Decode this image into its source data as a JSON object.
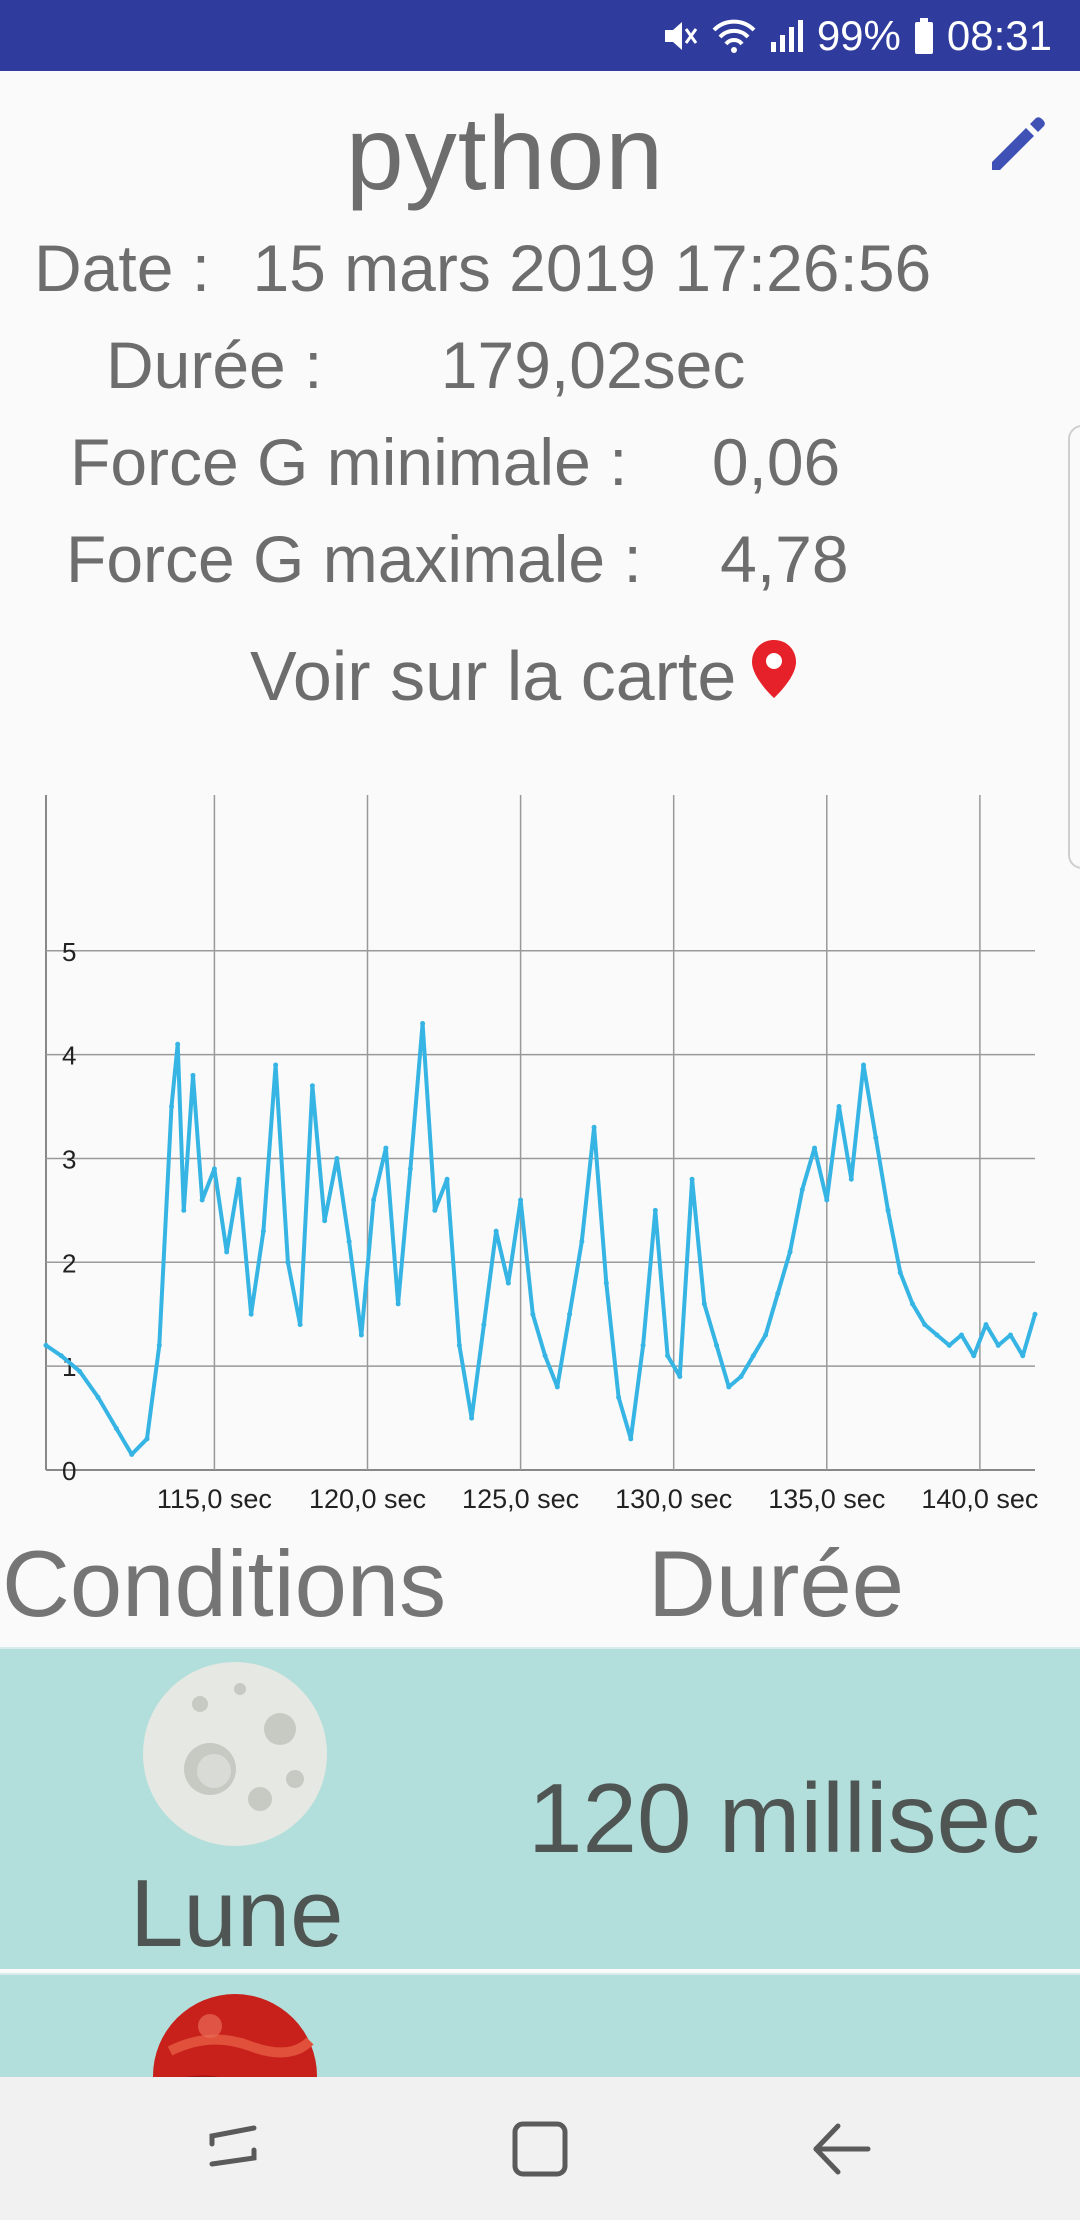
{
  "status_bar": {
    "icons": [
      "mute-icon",
      "wifi-icon",
      "signal-icon",
      "battery-icon"
    ],
    "battery": "99%",
    "time": "08:31"
  },
  "header": {
    "title": "python"
  },
  "info": {
    "date_label": "Date :",
    "date_value": "15 mars 2019 17:26:56",
    "duration_label": "Durée :",
    "duration_value": "179,02sec",
    "gmin_label": "Force G minimale :",
    "gmin_value": "0,06",
    "gmax_label": "Force G maximale :",
    "gmax_value": "4,78"
  },
  "map_link": {
    "label": "Voir sur la carte",
    "icon": "map-pin-icon"
  },
  "chart_data": {
    "type": "line",
    "series": [
      {
        "color": "#36b5e4",
        "x": [
          109.5,
          110.0,
          110.6,
          111.2,
          111.8,
          112.3,
          112.8,
          113.2,
          113.6,
          113.8,
          114.0,
          114.3,
          114.6,
          115.0,
          115.4,
          115.8,
          116.2,
          116.6,
          117.0,
          117.4,
          117.8,
          118.2,
          118.6,
          119.0,
          119.4,
          119.8,
          120.2,
          120.6,
          121.0,
          121.4,
          121.8,
          122.2,
          122.6,
          123.0,
          123.4,
          123.8,
          124.2,
          124.6,
          125.0,
          125.4,
          125.8,
          126.2,
          126.6,
          127.0,
          127.4,
          127.8,
          128.2,
          128.6,
          129.0,
          129.4,
          129.8,
          130.2,
          130.6,
          131.0,
          131.4,
          131.8,
          132.2,
          132.6,
          133.0,
          133.4,
          133.8,
          134.2,
          134.6,
          135.0,
          135.4,
          135.8,
          136.2,
          136.6,
          137.0,
          137.4,
          137.8,
          138.2,
          138.6,
          139.0,
          139.4,
          139.8,
          140.2,
          140.6,
          141.0,
          141.4,
          141.8
        ],
        "y": [
          1.2,
          1.1,
          0.95,
          0.7,
          0.4,
          0.15,
          0.3,
          1.2,
          3.5,
          4.1,
          2.5,
          3.8,
          2.6,
          2.9,
          2.1,
          2.8,
          1.5,
          2.3,
          3.9,
          2.0,
          1.4,
          3.7,
          2.4,
          3.0,
          2.2,
          1.3,
          2.6,
          3.1,
          1.6,
          2.9,
          4.3,
          2.5,
          2.8,
          1.2,
          0.5,
          1.4,
          2.3,
          1.8,
          2.6,
          1.5,
          1.1,
          0.8,
          1.5,
          2.2,
          3.3,
          1.8,
          0.7,
          0.3,
          1.2,
          2.5,
          1.1,
          0.9,
          2.8,
          1.6,
          1.2,
          0.8,
          0.9,
          1.1,
          1.3,
          1.7,
          2.1,
          2.7,
          3.1,
          2.6,
          3.5,
          2.8,
          3.9,
          3.2,
          2.5,
          1.9,
          1.6,
          1.4,
          1.3,
          1.2,
          1.3,
          1.1,
          1.4,
          1.2,
          1.3,
          1.1,
          1.5
        ]
      }
    ],
    "yticks": [
      "0",
      "1",
      "2",
      "3",
      "4",
      "5"
    ],
    "xticks": [
      "115,0 sec",
      "120,0 sec",
      "125,0 sec",
      "130,0 sec",
      "135,0 sec",
      "140,0 sec"
    ],
    "ylim": [
      0,
      6.5
    ],
    "xlim": [
      109.5,
      141.8
    ],
    "grid": true
  },
  "table": {
    "col_conditions": "Conditions",
    "col_duration": "Durée",
    "rows": [
      {
        "icon": "moon-icon",
        "name": "Lune",
        "duration": "120 millisec"
      },
      {
        "icon": "mars-icon",
        "name": "",
        "duration": ""
      }
    ]
  },
  "nav": {
    "icons": [
      "recent-apps-icon",
      "home-icon",
      "back-icon"
    ]
  }
}
